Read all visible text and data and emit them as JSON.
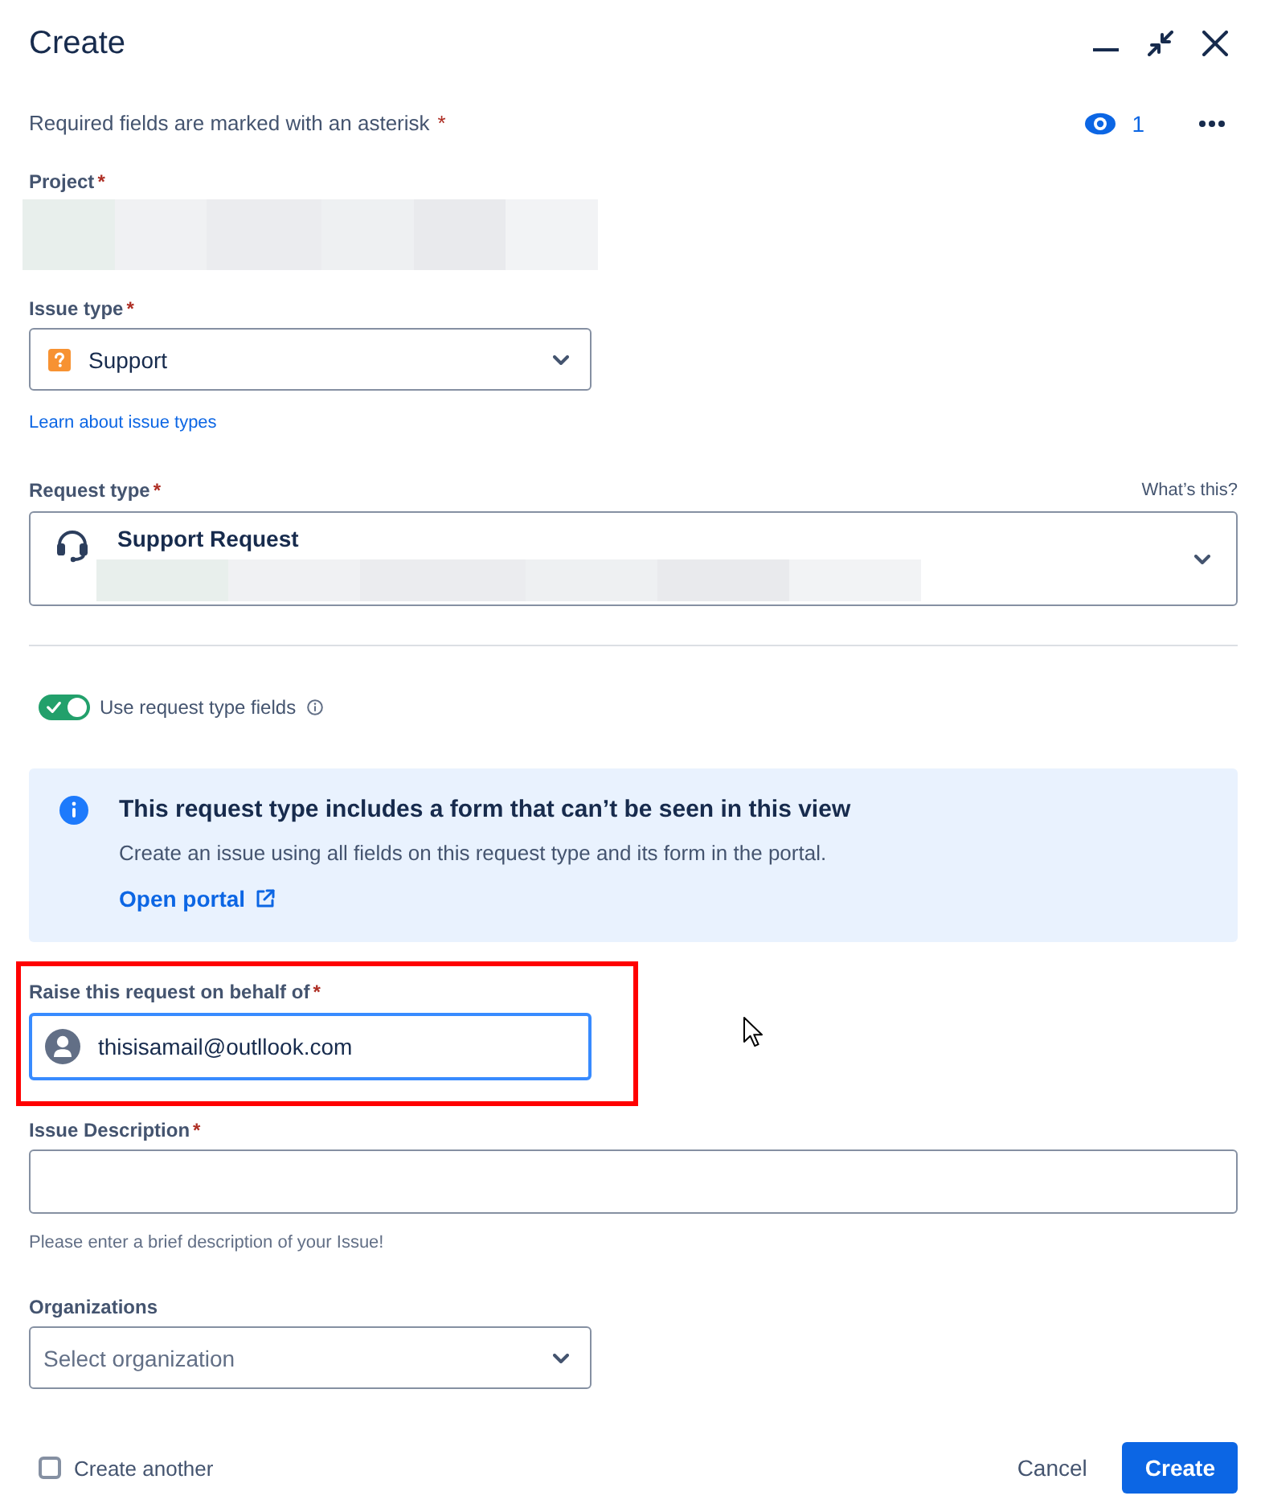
{
  "window": {
    "title": "Create"
  },
  "required_note": {
    "text": "Required fields are marked with an asterisk",
    "asterisk": "*"
  },
  "watchers": {
    "count": "1"
  },
  "project": {
    "label": "Project",
    "asterisk": "*"
  },
  "issue_type": {
    "label": "Issue type",
    "asterisk": "*",
    "value": "Support",
    "link": "Learn about issue types"
  },
  "request_type": {
    "label": "Request type",
    "asterisk": "*",
    "help_link": "What’s this?",
    "value": "Support Request"
  },
  "request_type_toggle": {
    "label": "Use request type fields",
    "on": true
  },
  "info_panel": {
    "title": "This request type includes a form that can’t be seen in this view",
    "body": "Create an issue using all fields on this request type and its form in the portal.",
    "link": "Open portal"
  },
  "fields": [
    {
      "kind": "user",
      "label": "Raise this request on behalf of",
      "asterisk": "*",
      "value": "thisisamail@outllook.com",
      "focused": true,
      "highlighted": true
    },
    {
      "kind": "text",
      "label": "Issue Description",
      "asterisk": "*",
      "helper": "Please enter a brief description of your Issue!"
    },
    {
      "kind": "select",
      "label": "Organizations",
      "placeholder": "Select organization"
    }
  ],
  "footer": {
    "create_another": {
      "label": "Create another",
      "checked": false
    },
    "buttons": [
      {
        "label": "Cancel",
        "kind": "subtle"
      },
      {
        "label": "Create",
        "kind": "primary"
      }
    ]
  }
}
